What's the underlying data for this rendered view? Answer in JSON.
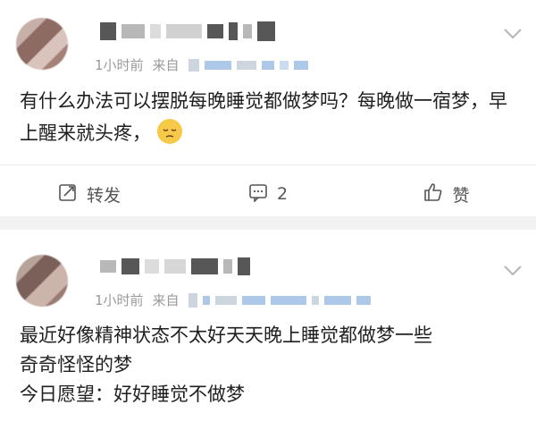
{
  "posts": [
    {
      "meta_time": "1小时前",
      "meta_source_prefix": "来自",
      "content": "有什么办法可以摆脱每晚睡觉都做梦吗？每晚做一宿梦，早上醒来就头疼，",
      "emoji": "pensive-face",
      "actions": {
        "repost_label": "转发",
        "comment_count": "2",
        "like_label": "赞"
      }
    },
    {
      "meta_time": "1小时前",
      "meta_source_prefix": "来自",
      "content_line1": "最近好像精神状态不太好天天晚上睡觉都做梦一些",
      "content_line2": "奇奇怪怪的梦",
      "content_line3": "今日愿望：好好睡觉不做梦"
    }
  ],
  "colors": {
    "accent_blue": "#6a9ad6",
    "meta_grey": "#9a9a9a",
    "separator": "#f2f2f2"
  }
}
